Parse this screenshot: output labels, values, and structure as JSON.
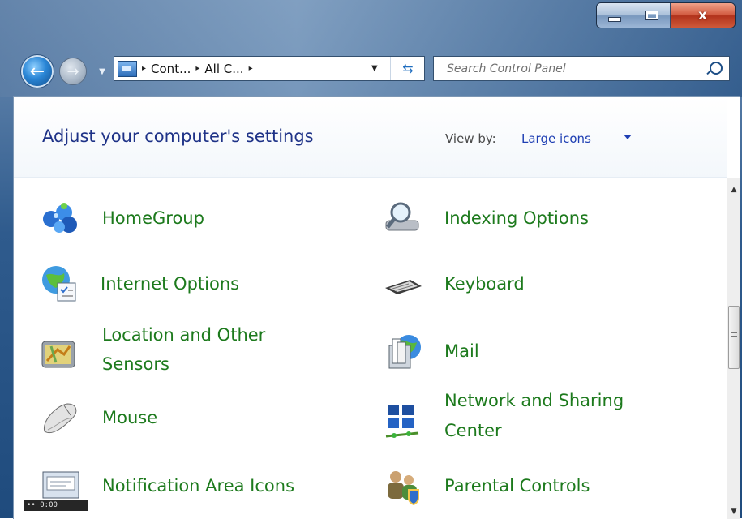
{
  "window": {
    "minimize_glyph": "minimize",
    "maximize_glyph": "maximize",
    "close_glyph": "x"
  },
  "nav": {
    "back_icon": "back-arrow-icon",
    "forward_icon": "forward-arrow-icon",
    "address": {
      "crumbs": [
        "Cont...",
        "All C..."
      ],
      "separator": "▸"
    },
    "search": {
      "placeholder": "Search Control Panel"
    }
  },
  "header": {
    "title": "Adjust your computer's settings",
    "view_by_label": "View by:",
    "view_by_value": "Large icons"
  },
  "items": [
    {
      "label": "HomeGroup",
      "icon": "homegroup-icon"
    },
    {
      "label": "Indexing Options",
      "icon": "indexing-options-icon"
    },
    {
      "label": "Internet Options",
      "icon": "internet-options-icon"
    },
    {
      "label": "Keyboard",
      "icon": "keyboard-icon"
    },
    {
      "label": "Location and Other Sensors",
      "icon": "location-sensors-icon"
    },
    {
      "label": "Mail",
      "icon": "mail-icon"
    },
    {
      "label": "Mouse",
      "icon": "mouse-icon"
    },
    {
      "label": "Network and Sharing Center",
      "icon": "network-sharing-icon"
    },
    {
      "label": "Notification Area Icons",
      "icon": "notification-area-icon"
    },
    {
      "label": "Parental Controls",
      "icon": "parental-controls-icon"
    }
  ],
  "status_chip": "•• 0:00",
  "colors": {
    "link_green": "#1d7a1d",
    "title_blue": "#1e3287",
    "view_link": "#1f3fb3"
  }
}
